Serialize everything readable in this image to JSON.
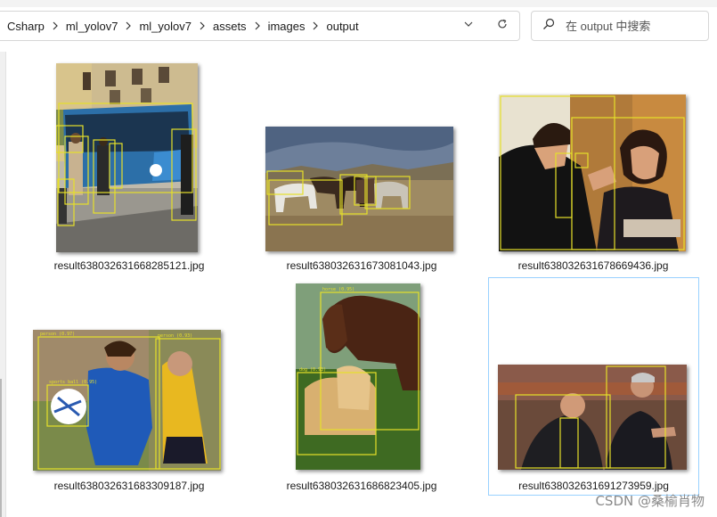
{
  "breadcrumb": [
    "Csharp",
    "ml_yolov7",
    "ml_yolov7",
    "assets",
    "images",
    "output"
  ],
  "search": {
    "placeholder": "在 output 中搜索"
  },
  "icons": {
    "separator": "chevron-right-icon",
    "history": "chevron-down-icon",
    "refresh": "refresh-icon",
    "search": "search-icon"
  },
  "files": [
    {
      "name": "result638032631668285121.jpg"
    },
    {
      "name": "result638032631673081043.jpg"
    },
    {
      "name": "result638032631678669436.jpg"
    },
    {
      "name": "result638032631683309187.jpg"
    },
    {
      "name": "result638032631686823405.jpg"
    },
    {
      "name": "result638032631691273959.jpg",
      "selected": true
    }
  ],
  "thumbnails": {
    "horse_dog_labels": [
      "horse (0.95)",
      "dog (0.93)"
    ],
    "soccer_labels": [
      "person (0.97)",
      "person (0.93)",
      "sports ball (0.95)"
    ]
  },
  "watermark": "CSDN @桑榆肖物",
  "colors": {
    "box": "#e6e02a",
    "selection": "#99d1ff"
  }
}
